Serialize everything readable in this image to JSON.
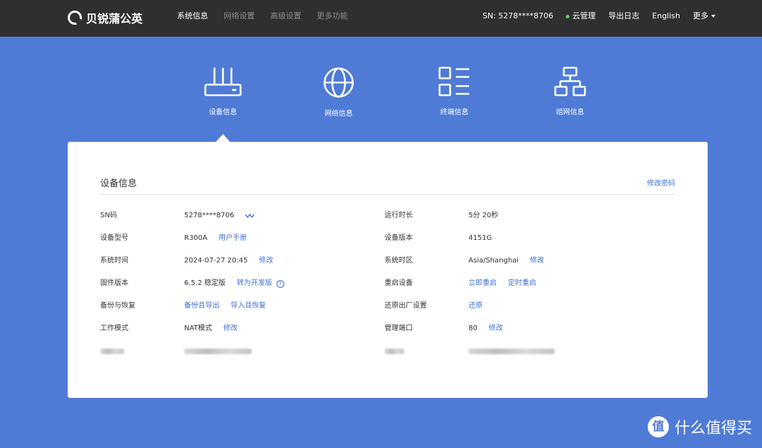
{
  "brand": {
    "name": "贝锐蒲公英"
  },
  "nav": {
    "tabs": [
      {
        "label": "系统信息"
      },
      {
        "label": "网络设置"
      },
      {
        "label": "高级设置"
      },
      {
        "label": "更多功能"
      }
    ],
    "sn": "SN:  5278****8706",
    "cloud": "云管理",
    "export_log": "导出日志",
    "language": "English",
    "more": "更多"
  },
  "categories": [
    {
      "label": "设备信息",
      "icon": "router-icon"
    },
    {
      "label": "网络信息",
      "icon": "globe-icon"
    },
    {
      "label": "终端信息",
      "icon": "list-icon"
    },
    {
      "label": "组网信息",
      "icon": "topology-icon"
    }
  ],
  "card": {
    "title": "设备信息",
    "change_password": "修改密码",
    "left": [
      {
        "label": "SN码",
        "value": "5278****8706"
      },
      {
        "label": "设备型号",
        "value": "R300A",
        "link": "用户手册"
      },
      {
        "label": "系统时间",
        "value": "2024-07-27 20:45",
        "link": "修改"
      },
      {
        "label": "固件版本",
        "value": "6.5.2 稳定版",
        "link": "转为开发版",
        "help": "?"
      },
      {
        "label": "备份与恢复",
        "link": "备份且导出",
        "link2": "导入且恢复"
      },
      {
        "label": "工作模式",
        "value": "NAT模式",
        "link": "修改"
      }
    ],
    "right": [
      {
        "label": "运行时长",
        "value": "5分 20秒"
      },
      {
        "label": "设备版本",
        "value": "4151G"
      },
      {
        "label": "系统时区",
        "value": "Asia/Shanghai",
        "link": "修改"
      },
      {
        "label": "重启设备",
        "link": "立即重启",
        "link2": "定时重启"
      },
      {
        "label": "还原出厂设置",
        "link": "还原"
      },
      {
        "label": "管理端口",
        "value": "80",
        "link": "修改"
      }
    ]
  },
  "watermark": {
    "badge": "值",
    "text": "什么值得买"
  }
}
